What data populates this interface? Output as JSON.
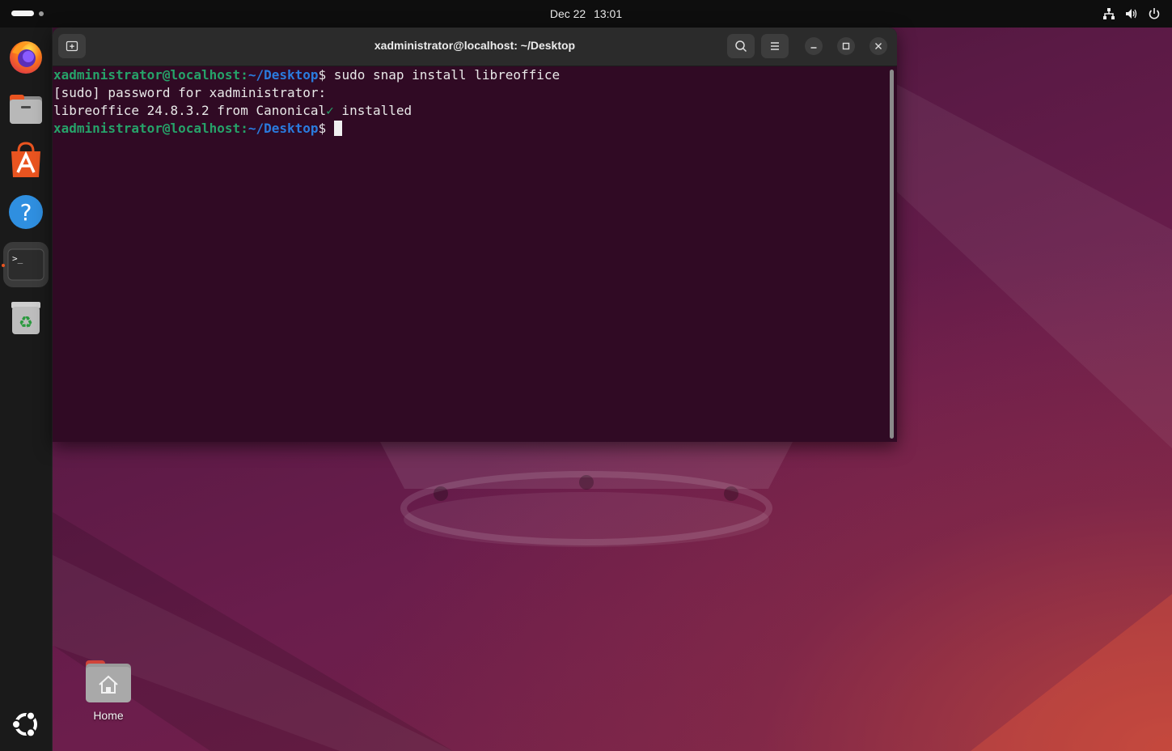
{
  "topbar": {
    "date": "Dec 22",
    "time": "13:01",
    "tray_icons": [
      "network-icon",
      "volume-icon",
      "power-icon"
    ]
  },
  "dock": {
    "items": [
      {
        "name": "Firefox",
        "icon": "firefox-icon"
      },
      {
        "name": "Files",
        "icon": "files-icon"
      },
      {
        "name": "App Center",
        "icon": "app-center-icon"
      },
      {
        "name": "Help",
        "icon": "help-icon"
      },
      {
        "name": "Terminal",
        "icon": "terminal-icon",
        "active": true
      },
      {
        "name": "Trash",
        "icon": "trash-icon"
      }
    ],
    "show_apps_icon": "ubuntu-logo-icon"
  },
  "terminal": {
    "title": "xadministrator@localhost: ~/Desktop",
    "lines": [
      {
        "user": "xadministrator@localhost",
        "sep": ":",
        "path": "~/Desktop",
        "prompt": "$",
        "command": " sudo snap install libreoffice"
      },
      {
        "text": "[sudo] password for xadministrator:"
      },
      {
        "text_before": "libreoffice 24.8.3.2 from Canonical",
        "check": "✓",
        "text_after": " installed"
      },
      {
        "user": "xadministrator@localhost",
        "sep": ":",
        "path": "~/Desktop",
        "prompt": "$",
        "command": " "
      }
    ]
  },
  "desktop": {
    "home_label": "Home"
  },
  "colors": {
    "terminal_bg": "#300a24",
    "prompt_user": "#26a269",
    "prompt_path": "#2a7bde",
    "accent": "#e95420"
  }
}
